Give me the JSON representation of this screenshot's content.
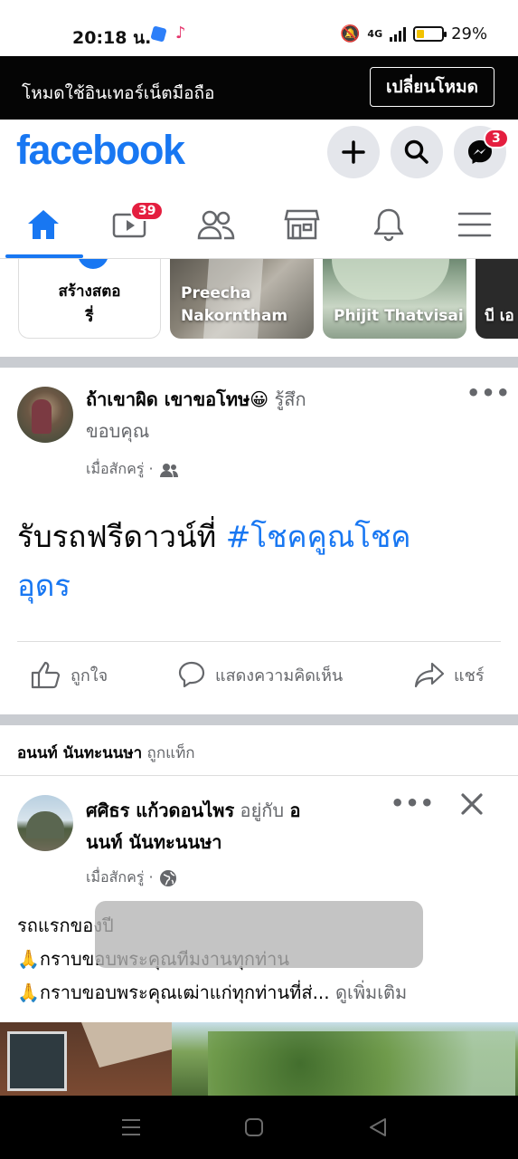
{
  "status_bar": {
    "time": "20:18 น.",
    "network": "4G",
    "battery": "29%",
    "battery_level": 0.29
  },
  "mode_bar": {
    "text": "โหมดใช้อินเทอร์เน็ตมือถือ",
    "button": "เปลี่ยนโหมด"
  },
  "header": {
    "logo": "facebook",
    "messenger_badge": "3"
  },
  "tabs": {
    "video_badge": "39",
    "active": "home"
  },
  "stories": {
    "create_label_line1": "สร้างสตอ",
    "create_label_line2": "รี่",
    "items": [
      {
        "name_line1": "Preecha",
        "name_line2": "Nakorntham"
      },
      {
        "name_line1": "Phijit Thatvisai",
        "name_line2": ""
      },
      {
        "name_line1": "บี เอ",
        "name_line2": ""
      }
    ]
  },
  "post1": {
    "author": "ถ้าเขาผิด เขาขอโทษ😀",
    "feeling_prefix": " รู้สึก",
    "feeling_line2": "ขอบคุณ",
    "time": "เมื่อสักครู่ ·",
    "text_plain": "รับรถฟรีดาวน์ที่ ",
    "hashtag_line1": "#โชคคูณโชค",
    "hashtag_line2": "อุดร",
    "like": "ถูกใจ",
    "comment": "แสดงความคิดเห็น",
    "share": "แชร์"
  },
  "tag_notice": {
    "name": "อนนท์ นันทะนนษา",
    "suffix": " ถูกแท็ก"
  },
  "post2": {
    "author": "ศศิธร แก้วดอนไพร",
    "with_text": " อยู่กับ ",
    "tagged_line1": "อ",
    "tagged_line2": "นนท์ นันทะนนษา",
    "time": "เมื่อสักครู่ ·",
    "line1": "รถแรกของปี",
    "line2": "🙏กราบขอบพระคุณทีมงานทุกท่าน",
    "line3": "🙏กราบขอบพระคุณเฒ่าแก่ทุกท่านที่ส่... ",
    "see_more": "ดูเพิ่มเติม"
  },
  "colors": {
    "brand": "#1877f2",
    "badge": "#e41e3f",
    "divider": "#c9ccd1"
  }
}
